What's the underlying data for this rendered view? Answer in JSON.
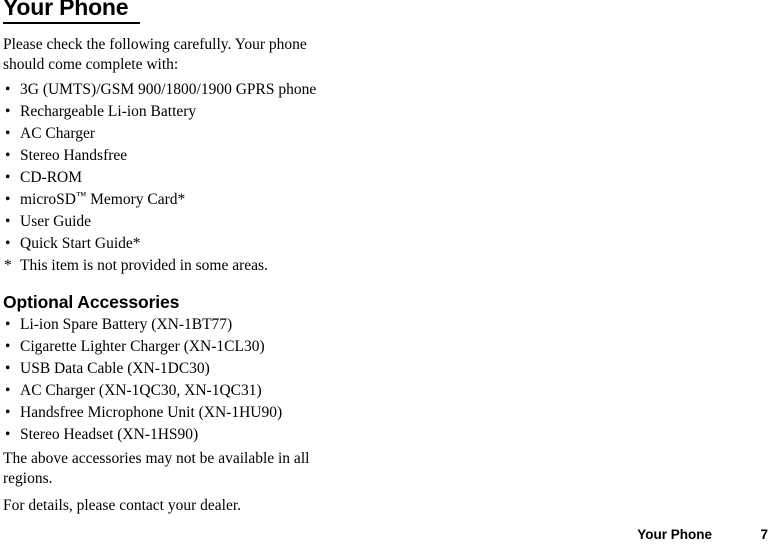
{
  "document": {
    "title": "Your Phone",
    "intro_paragraph": "Please check the following carefully. Your phone should come complete with:",
    "box_contents": [
      "3G (UMTS)/GSM 900/1800/1900 GPRS phone",
      "Rechargeable Li-ion Battery",
      "AC Charger",
      "Stereo Handsfree",
      "CD-ROM",
      "microSD™ Memory Card*",
      "User Guide",
      "Quick Start Guide*"
    ],
    "footnote": {
      "marker": "*",
      "text": "This item is not provided in some areas."
    },
    "optional_section": {
      "heading": "Optional Accessories",
      "items": [
        "Li-ion Spare Battery (XN-1BT77)",
        "Cigarette Lighter Charger (XN-1CL30)",
        "USB Data Cable (XN-1DC30)",
        "AC Charger (XN-1QC30, XN-1QC31)",
        "Handsfree Microphone Unit (XN-1HU90)",
        "Stereo Headset (XN-1HS90)"
      ],
      "availability_note": "The above accessories may not be available in all regions.",
      "dealer_note": "For details, please contact your dealer."
    },
    "bullet_glyph": "•"
  },
  "footer": {
    "section_label": "Your Phone",
    "page_number": "7"
  },
  "colors": {
    "text": "#000000",
    "background": "#ffffff",
    "rule": "#000000"
  }
}
